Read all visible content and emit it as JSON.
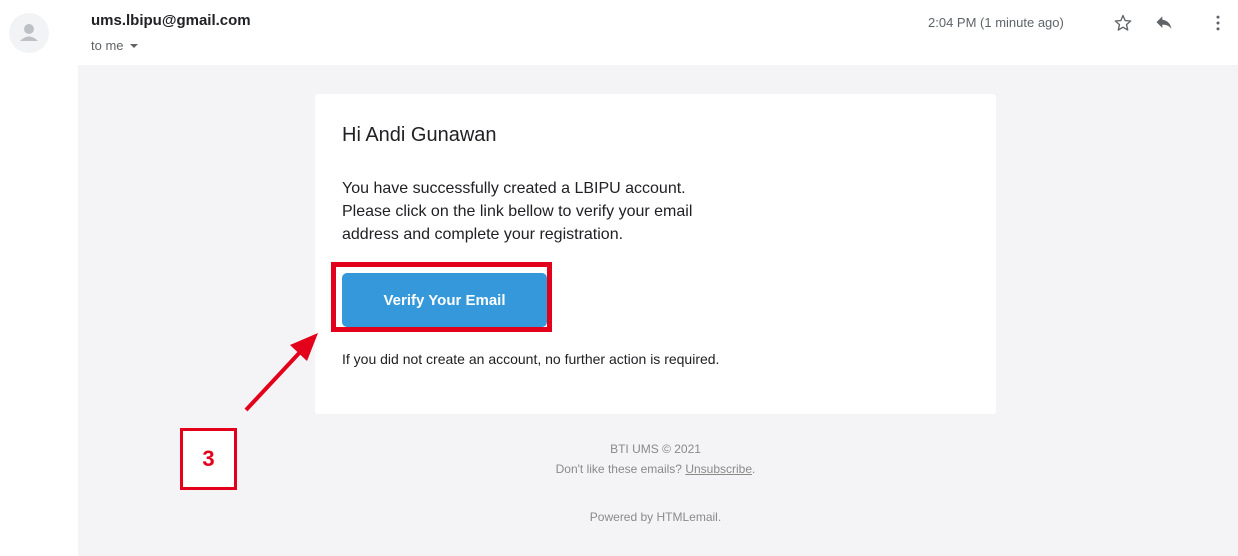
{
  "header": {
    "sender": "ums.lbipu@gmail.com",
    "recipient": "to me",
    "timestamp": "2:04 PM (1 minute ago)"
  },
  "email": {
    "greeting": "Hi Andi Gunawan",
    "body_lines": [
      "You have successfully created a LBIPU account.",
      "Please click on the link bellow to verify your email",
      "address and complete your registration."
    ],
    "verify_button_label": "Verify Your Email",
    "note": "If you did not create an account, no further action is required."
  },
  "footer": {
    "copyright": "BTI UMS © 2021",
    "unsubscribe_prefix": "Don't like these emails?",
    "unsubscribe_link": "Unsubscribe",
    "unsubscribe_suffix": ".",
    "powered_by": "Powered by HTMLemail."
  },
  "annotation": {
    "step_number": "3",
    "color": "#e3001b"
  },
  "icons": {
    "star": "star-outline-icon",
    "reply": "reply-icon",
    "more": "more-vertical-icon"
  }
}
